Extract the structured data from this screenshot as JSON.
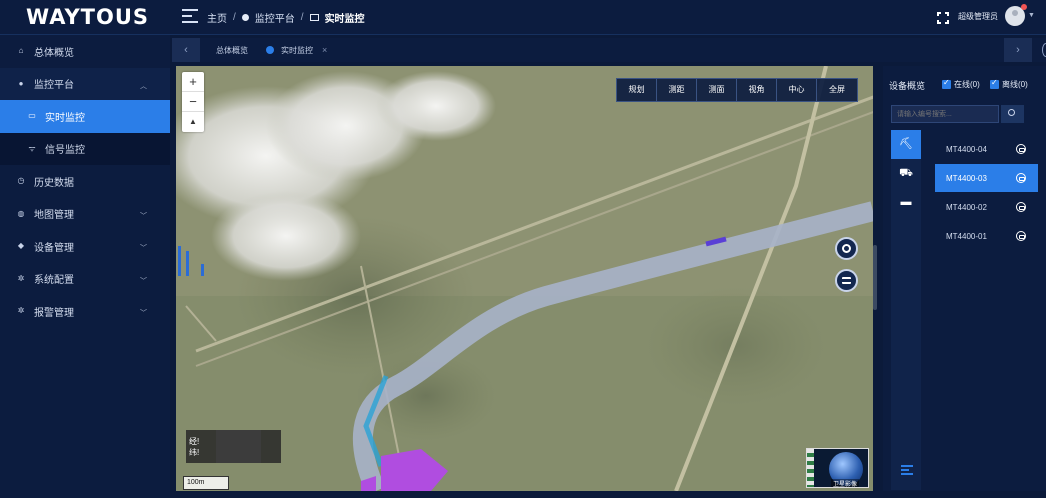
{
  "app": {
    "logo": "WAYTOUS"
  },
  "header": {
    "breadcrumb": [
      "主页",
      "监控平台",
      "实时监控"
    ],
    "user_name": "超级管理员"
  },
  "sidebar": {
    "items": [
      {
        "label": "总体概览",
        "icon": "home-icon"
      },
      {
        "label": "监控平台",
        "icon": "dot-icon",
        "chevron": "up"
      },
      {
        "label": "实时监控",
        "icon": "monitor-icon",
        "active": true
      },
      {
        "label": "信号监控",
        "icon": "wifi-icon"
      },
      {
        "label": "历史数据",
        "icon": "clock-icon"
      },
      {
        "label": "地图管理",
        "icon": "globe-icon",
        "chevron": "down"
      },
      {
        "label": "设备管理",
        "icon": "tag-icon",
        "chevron": "down"
      },
      {
        "label": "系统配置",
        "icon": "gear-icon",
        "chevron": "down"
      },
      {
        "label": "报警管理",
        "icon": "gear-icon",
        "chevron": "down"
      }
    ]
  },
  "tabs": [
    {
      "label": "总体概览"
    },
    {
      "label": "实时监控",
      "active": true
    }
  ],
  "map": {
    "tools": [
      "规划",
      "测距",
      "测面",
      "视角",
      "中心",
      "全屏"
    ],
    "zoom_in": "+",
    "zoom_out": "−",
    "compass": "▲",
    "coord_lines": [
      "经!",
      "纬!"
    ],
    "scale": "100m",
    "minimap_label": "卫星影像"
  },
  "panel": {
    "title": "设备概览",
    "online_label": "在线(0)",
    "offline_label": "离线(0)",
    "search_placeholder": "请输入编号搜索...",
    "categories": [
      "excavator-icon",
      "loader-icon",
      "truck-icon"
    ],
    "devices": [
      {
        "name": "MT4400-04"
      },
      {
        "name": "MT4400-03",
        "selected": true
      },
      {
        "name": "MT4400-02"
      },
      {
        "name": "MT4400-01"
      }
    ]
  },
  "colors": {
    "accent": "#2b7ee8",
    "background": "#0c1c3f",
    "route": "#a7b3c9",
    "zone": "#b04de0"
  }
}
